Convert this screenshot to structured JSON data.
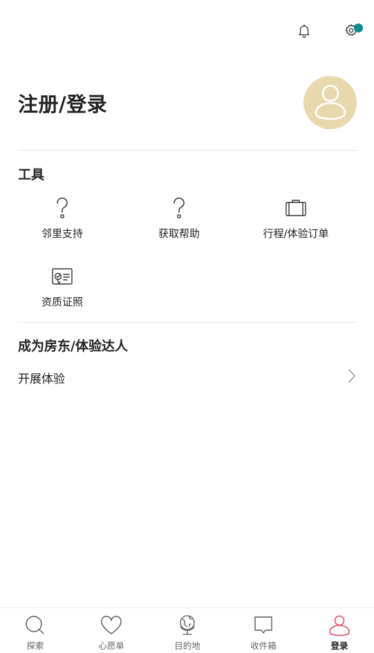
{
  "header": {
    "bell_icon": "bell-icon",
    "settings_icon": "gear-icon",
    "notification_dot_color": "#0f8b8d"
  },
  "profile": {
    "title": "注册/登录",
    "avatar_icon": "user-icon",
    "avatar_bg": "#e8d8ae"
  },
  "tools": {
    "section_title": "工具",
    "items": [
      {
        "label": "邻里支持",
        "icon": "question-icon"
      },
      {
        "label": "获取帮助",
        "icon": "question-icon"
      },
      {
        "label": "行程/体验订单",
        "icon": "suitcase-icon"
      },
      {
        "label": "资质证照",
        "icon": "certificate-icon"
      }
    ]
  },
  "host": {
    "section_title": "成为房东/体验达人",
    "row_label": "开展体验",
    "row_icon": "chevron-right-icon"
  },
  "tabbar": {
    "items": [
      {
        "label": "探索",
        "icon": "search-icon",
        "active": false
      },
      {
        "label": "心愿单",
        "icon": "heart-icon",
        "active": false
      },
      {
        "label": "目的地",
        "icon": "globe-icon",
        "active": false
      },
      {
        "label": "收件箱",
        "icon": "chat-icon",
        "active": false
      },
      {
        "label": "登录",
        "icon": "user-icon",
        "active": true
      }
    ],
    "active_color": "#e0435e"
  }
}
